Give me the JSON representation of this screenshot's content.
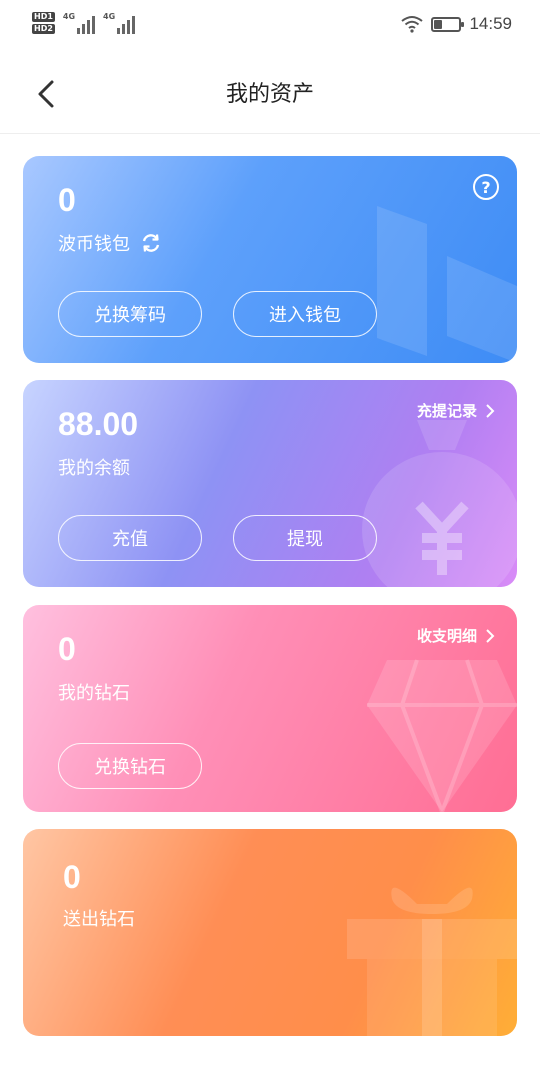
{
  "status_bar": {
    "hd1": "HD1",
    "hd2": "HD2",
    "net1": "4G",
    "net2": "4G",
    "time": "14:59",
    "battery_level": 0.3
  },
  "nav": {
    "title": "我的资产"
  },
  "wallet_card": {
    "value": "0",
    "label": "波币钱包",
    "button_exchange": "兑换筹码",
    "button_enter": "进入钱包",
    "help": "?"
  },
  "balance_card": {
    "value": "88.00",
    "label": "我的余额",
    "link": "充提记录",
    "button_recharge": "充值",
    "button_withdraw": "提现"
  },
  "diamond_card": {
    "value": "0",
    "label": "我的钻石",
    "link": "收支明细",
    "button_exchange": "兑换钻石"
  },
  "sent_card": {
    "value": "0",
    "label": "送出钻石"
  },
  "colors": {
    "wallet": "#4a93f7",
    "balance": "#a586f4",
    "diamond": "#ff7fa4",
    "sent": "#ff9448"
  }
}
